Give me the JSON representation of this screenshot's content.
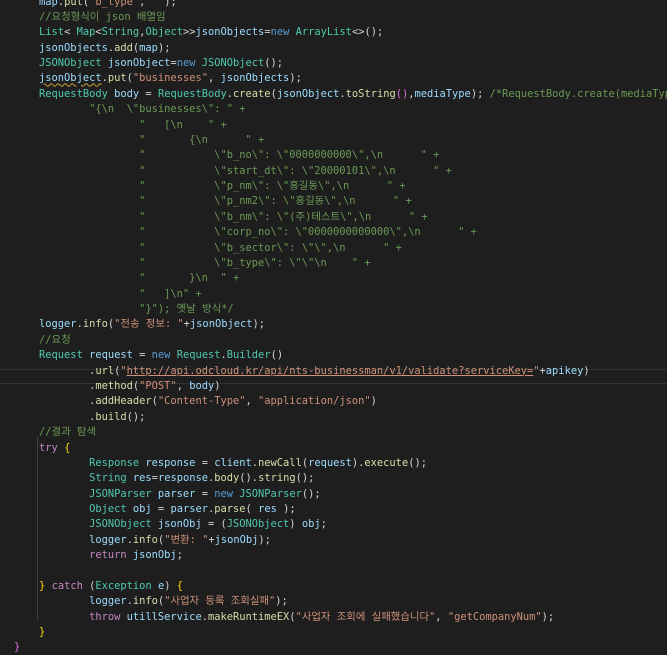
{
  "editor": {
    "colors": {
      "background": "#1e1e1e",
      "keyword": "#569cd6",
      "control": "#c586c0",
      "type": "#4ec9b0",
      "variable": "#9cdcfe",
      "function": "#dcdcaa",
      "string": "#ce9178",
      "comment": "#6a9955",
      "text": "#d4d4d4",
      "bracket": "#ffd700"
    },
    "lines": [
      [
        [
          "plain",
          "    "
        ],
        [
          "var",
          "map"
        ],
        [
          "plain",
          "."
        ],
        [
          "fn",
          "put"
        ],
        [
          "plain",
          "("
        ],
        [
          "str",
          "\"b_type\""
        ],
        [
          "plain",
          ", "
        ],
        [
          "str",
          "\"\""
        ],
        [
          "plain",
          ");"
        ]
      ],
      [
        [
          "plain",
          "    "
        ],
        [
          "cmt",
          "//요청형식이 json 배열임"
        ]
      ],
      [
        [
          "plain",
          "    "
        ],
        [
          "type",
          "List"
        ],
        [
          "plain",
          "< "
        ],
        [
          "type",
          "Map"
        ],
        [
          "plain",
          "<"
        ],
        [
          "type",
          "String"
        ],
        [
          "plain",
          ","
        ],
        [
          "type",
          "Object"
        ],
        [
          "plain",
          ">>"
        ],
        [
          "var",
          "jsonObjects"
        ],
        [
          "plain",
          "="
        ],
        [
          "kw",
          "new"
        ],
        [
          "plain",
          " "
        ],
        [
          "type",
          "ArrayList"
        ],
        [
          "plain",
          "<>();"
        ]
      ],
      [
        [
          "plain",
          "    "
        ],
        [
          "var",
          "jsonObjects"
        ],
        [
          "plain",
          "."
        ],
        [
          "fn",
          "add"
        ],
        [
          "plain",
          "("
        ],
        [
          "var",
          "map"
        ],
        [
          "plain",
          ");"
        ]
      ],
      [
        [
          "plain",
          "    "
        ],
        [
          "type",
          "JSONObject"
        ],
        [
          "plain",
          " "
        ],
        [
          "var",
          "jsonObject"
        ],
        [
          "plain",
          "="
        ],
        [
          "kw",
          "new"
        ],
        [
          "plain",
          " "
        ],
        [
          "type",
          "JSONObject"
        ],
        [
          "plain",
          "();"
        ]
      ],
      [
        [
          "plain",
          "    "
        ],
        [
          "var",
          "jsonObject",
          "squig"
        ],
        [
          "plain",
          "."
        ],
        [
          "fn",
          "put"
        ],
        [
          "plain",
          "("
        ],
        [
          "str",
          "\"businesses\""
        ],
        [
          "plain",
          ", "
        ],
        [
          "var",
          "jsonObjects"
        ],
        [
          "plain",
          ");"
        ]
      ],
      [
        [
          "plain",
          "    "
        ],
        [
          "type",
          "RequestBody"
        ],
        [
          "plain",
          " "
        ],
        [
          "var",
          "body"
        ],
        [
          "plain",
          " = "
        ],
        [
          "type",
          "RequestBody"
        ],
        [
          "plain",
          "."
        ],
        [
          "fn",
          "create"
        ],
        [
          "plain",
          "("
        ],
        [
          "var",
          "jsonObject"
        ],
        [
          "plain",
          "."
        ],
        [
          "fn",
          "toString"
        ],
        [
          "brk2",
          "()"
        ],
        [
          "plain",
          ","
        ],
        [
          "var",
          "mediaType"
        ],
        [
          "plain",
          "); "
        ],
        [
          "cmt",
          "/*RequestBody.create(mediaType,"
        ]
      ],
      [
        [
          "cmt",
          "            \"{\\n  \\\"businesses\\\": \" +"
        ]
      ],
      [
        [
          "cmt",
          "                    \"   [\\n    \" +"
        ]
      ],
      [
        [
          "cmt",
          "                    \"       {\\n      \" +"
        ]
      ],
      [
        [
          "cmt",
          "                    \"           \\\"b_no\\\": \\\"0000000000\\\",\\n      \" +"
        ]
      ],
      [
        [
          "cmt",
          "                    \"           \\\"start_dt\\\": \\\"20000101\\\",\\n      \" +"
        ]
      ],
      [
        [
          "cmt",
          "                    \"           \\\"p_nm\\\": \\\"홍길동\\\",\\n      \" +"
        ]
      ],
      [
        [
          "cmt",
          "                    \"           \\\"p_nm2\\\": \\\"홍길동\\\",\\n      \" +"
        ]
      ],
      [
        [
          "cmt",
          "                    \"           \\\"b_nm\\\": \\\"(주)테스트\\\",\\n      \" +"
        ]
      ],
      [
        [
          "cmt",
          "                    \"           \\\"corp_no\\\": \\\"0000000000000\\\",\\n      \" +"
        ]
      ],
      [
        [
          "cmt",
          "                    \"           \\\"b_sector\\\": \\\"\\\",\\n      \" +"
        ]
      ],
      [
        [
          "cmt",
          "                    \"           \\\"b_type\\\": \\\"\\\"\\n    \" +"
        ]
      ],
      [
        [
          "cmt",
          "                    \"       }\\n  \" +"
        ]
      ],
      [
        [
          "cmt",
          "                    \"   ]\\n\" +"
        ]
      ],
      [
        [
          "cmt",
          "                    \"}\"); 옛날 방식*/"
        ]
      ],
      [
        [
          "plain",
          "    "
        ],
        [
          "var",
          "logger"
        ],
        [
          "plain",
          "."
        ],
        [
          "fn",
          "info"
        ],
        [
          "plain",
          "("
        ],
        [
          "str",
          "\"전송 정보: \""
        ],
        [
          "plain",
          "+"
        ],
        [
          "var",
          "jsonObject"
        ],
        [
          "plain",
          ");"
        ]
      ],
      [
        [
          "plain",
          "    "
        ],
        [
          "cmt",
          "//요청"
        ]
      ],
      [
        [
          "plain",
          "    "
        ],
        [
          "type",
          "Request"
        ],
        [
          "plain",
          " "
        ],
        [
          "var",
          "request"
        ],
        [
          "plain",
          " = "
        ],
        [
          "kw",
          "new"
        ],
        [
          "plain",
          " "
        ],
        [
          "type",
          "Request"
        ],
        [
          "plain",
          "."
        ],
        [
          "type",
          "Builder"
        ],
        [
          "plain",
          "()"
        ]
      ],
      [
        [
          "plain",
          "            ."
        ],
        [
          "fn",
          "url"
        ],
        [
          "plain",
          "("
        ],
        [
          "str",
          "\""
        ],
        [
          "str",
          "http://api.odcloud.kr/api/nts-businessman/v1/validate?serviceKey=",
          "url"
        ],
        [
          "str",
          "\""
        ],
        [
          "plain",
          "+"
        ],
        [
          "var",
          "apikey"
        ],
        [
          "plain",
          ")"
        ]
      ],
      [
        [
          "plain",
          "            ."
        ],
        [
          "fn",
          "method"
        ],
        [
          "plain",
          "("
        ],
        [
          "str",
          "\"POST\""
        ],
        [
          "plain",
          ", "
        ],
        [
          "var",
          "body"
        ],
        [
          "plain",
          ")"
        ]
      ],
      [
        [
          "plain",
          "            ."
        ],
        [
          "fn",
          "addHeader"
        ],
        [
          "plain",
          "("
        ],
        [
          "str",
          "\"Content-Type\""
        ],
        [
          "plain",
          ", "
        ],
        [
          "str",
          "\"application/json\""
        ],
        [
          "plain",
          ")"
        ]
      ],
      [
        [
          "plain",
          "            ."
        ],
        [
          "fn",
          "build"
        ],
        [
          "plain",
          "();"
        ]
      ],
      [
        [
          "plain",
          "    "
        ],
        [
          "cmt",
          "//결과 탐색"
        ]
      ],
      [
        [
          "plain",
          "    "
        ],
        [
          "ctl",
          "try"
        ],
        [
          "plain",
          " "
        ],
        [
          "brk",
          "{"
        ]
      ],
      [
        [
          "plain",
          "            "
        ],
        [
          "type",
          "Response"
        ],
        [
          "plain",
          " "
        ],
        [
          "var",
          "response"
        ],
        [
          "plain",
          " = "
        ],
        [
          "var",
          "client"
        ],
        [
          "plain",
          "."
        ],
        [
          "fn",
          "newCall"
        ],
        [
          "plain",
          "("
        ],
        [
          "var",
          "request"
        ],
        [
          "plain",
          ")."
        ],
        [
          "fn",
          "execute"
        ],
        [
          "plain",
          "();"
        ]
      ],
      [
        [
          "plain",
          "            "
        ],
        [
          "type",
          "String"
        ],
        [
          "plain",
          " "
        ],
        [
          "var",
          "res"
        ],
        [
          "plain",
          "="
        ],
        [
          "var",
          "response"
        ],
        [
          "plain",
          "."
        ],
        [
          "fn",
          "body"
        ],
        [
          "plain",
          "()."
        ],
        [
          "fn",
          "string"
        ],
        [
          "plain",
          "();"
        ]
      ],
      [
        [
          "plain",
          "            "
        ],
        [
          "type",
          "JSONParser"
        ],
        [
          "plain",
          " "
        ],
        [
          "var",
          "parser"
        ],
        [
          "plain",
          " = "
        ],
        [
          "kw",
          "new"
        ],
        [
          "plain",
          " "
        ],
        [
          "type",
          "JSONParser"
        ],
        [
          "plain",
          "();"
        ]
      ],
      [
        [
          "plain",
          "            "
        ],
        [
          "type",
          "Object"
        ],
        [
          "plain",
          " "
        ],
        [
          "var",
          "obj"
        ],
        [
          "plain",
          " = "
        ],
        [
          "var",
          "parser"
        ],
        [
          "plain",
          "."
        ],
        [
          "fn",
          "parse"
        ],
        [
          "plain",
          "( "
        ],
        [
          "var",
          "res"
        ],
        [
          "plain",
          " );"
        ]
      ],
      [
        [
          "plain",
          "            "
        ],
        [
          "type",
          "JSONObject"
        ],
        [
          "plain",
          " "
        ],
        [
          "var",
          "jsonObj"
        ],
        [
          "plain",
          " = ("
        ],
        [
          "type",
          "JSONObject"
        ],
        [
          "plain",
          ") "
        ],
        [
          "var",
          "obj"
        ],
        [
          "plain",
          ";"
        ]
      ],
      [
        [
          "plain",
          "            "
        ],
        [
          "var",
          "logger"
        ],
        [
          "plain",
          "."
        ],
        [
          "fn",
          "info"
        ],
        [
          "plain",
          "("
        ],
        [
          "str",
          "\"변환: \""
        ],
        [
          "plain",
          "+"
        ],
        [
          "var",
          "jsonObj"
        ],
        [
          "plain",
          ");"
        ]
      ],
      [
        [
          "plain",
          "            "
        ],
        [
          "ctl",
          "return"
        ],
        [
          "plain",
          " "
        ],
        [
          "var",
          "jsonObj"
        ],
        [
          "plain",
          ";"
        ]
      ],
      [],
      [
        [
          "plain",
          "    "
        ],
        [
          "brk",
          "}"
        ],
        [
          "plain",
          " "
        ],
        [
          "ctl",
          "catch"
        ],
        [
          "plain",
          " ("
        ],
        [
          "type",
          "Exception"
        ],
        [
          "plain",
          " "
        ],
        [
          "var",
          "e"
        ],
        [
          "plain",
          ") "
        ],
        [
          "brk",
          "{"
        ]
      ],
      [
        [
          "plain",
          "            "
        ],
        [
          "var",
          "logger"
        ],
        [
          "plain",
          "."
        ],
        [
          "fn",
          "info"
        ],
        [
          "plain",
          "("
        ],
        [
          "str",
          "\"사업자 등록 조회실패\""
        ],
        [
          "plain",
          ");"
        ]
      ],
      [
        [
          "plain",
          "            "
        ],
        [
          "ctl",
          "throw"
        ],
        [
          "plain",
          " "
        ],
        [
          "var",
          "utillService"
        ],
        [
          "plain",
          "."
        ],
        [
          "fn",
          "makeRuntimeEX"
        ],
        [
          "plain",
          "("
        ],
        [
          "str",
          "\"사업자 조회에 실패했습니다\""
        ],
        [
          "plain",
          ", "
        ],
        [
          "str",
          "\"getCompanyNum\""
        ],
        [
          "plain",
          ");"
        ]
      ],
      [
        [
          "plain",
          "    "
        ],
        [
          "brk",
          "}"
        ]
      ],
      [
        [
          "brk2",
          "}"
        ]
      ]
    ]
  }
}
